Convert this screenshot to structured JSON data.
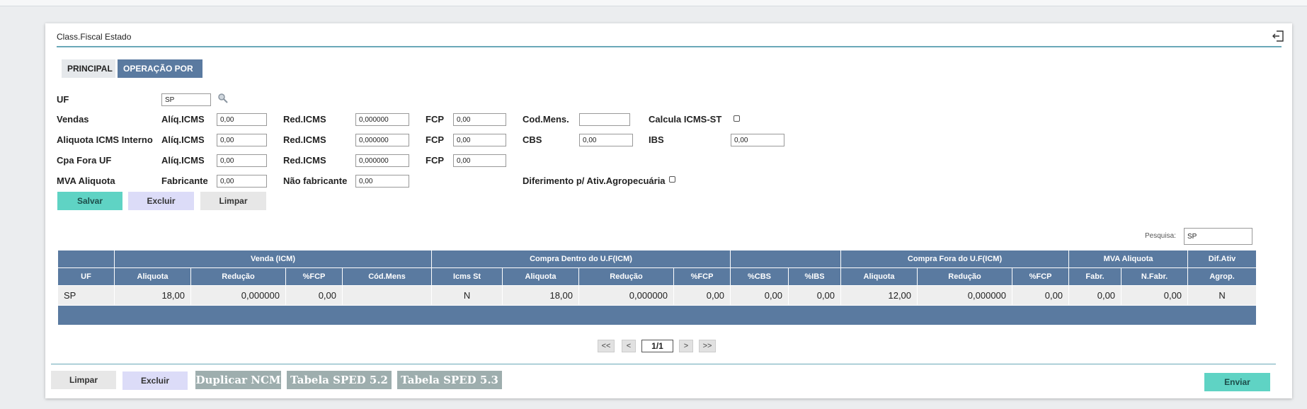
{
  "form": {
    "title": "Class.Fiscal Estado",
    "tabs": [
      "PRINCIPAL",
      "OPERAÇÃO POR UF"
    ],
    "uf_label": "UF",
    "uf_value": "SP",
    "rows": {
      "vendas": {
        "label": "Vendas",
        "aliq_label": "Alíq.ICMS",
        "aliq": "0,00",
        "red_label": "Red.ICMS",
        "red": "0,000000",
        "fcp_label": "FCP",
        "fcp": "0,00",
        "cod_label": "Cod.Mens.",
        "cod": "",
        "st_label": "Calcula ICMS-ST"
      },
      "interno": {
        "label": "Aliquota ICMS Interno",
        "aliq_label": "Alíq.ICMS",
        "aliq": "0,00",
        "red_label": "Red.ICMS",
        "red": "0,000000",
        "fcp_label": "FCP",
        "fcp": "0,00",
        "cbs_label": "CBS",
        "cbs": "0,00",
        "ibs_label": "IBS",
        "ibs": "0,00"
      },
      "cpa": {
        "label": "Cpa Fora UF",
        "aliq_label": "Alíq.ICMS",
        "aliq": "0,00",
        "red_label": "Red.ICMS",
        "red": "0,000000",
        "fcp_label": "FCP",
        "fcp": "0,00"
      },
      "mva": {
        "label": "MVA Aliquota",
        "fab_label": "Fabricante",
        "fab": "0,00",
        "nfab_label": "Não fabricante",
        "nfab": "0,00",
        "dif_label": "Diferimento p/ Ativ.Agropecuária"
      }
    },
    "buttons": {
      "save": "Salvar",
      "delete": "Excluir",
      "clear": "Limpar"
    }
  },
  "search": {
    "label": "Pesquisa:",
    "value": "SP"
  },
  "table": {
    "groups": [
      "Venda (ICM)",
      "Compra Dentro do U.F(ICM)",
      "",
      "Compra Fora do U.F(ICM)",
      "MVA Aliquota",
      "Dif.Ativ"
    ],
    "columns": [
      "UF",
      "Aliquota",
      "Redução",
      "%FCP",
      "Cód.Mens",
      "Icms St",
      "Aliquota",
      "Redução",
      "%FCP",
      "%CBS",
      "%IBS",
      "Aliquota",
      "Redução",
      "%FCP",
      "Fabr.",
      "N.Fabr.",
      "Agrop."
    ],
    "rows": [
      [
        "SP",
        "18,00",
        "0,000000",
        "0,00",
        "",
        "N",
        "18,00",
        "0,000000",
        "0,00",
        "0,00",
        "0,00",
        "12,00",
        "0,000000",
        "0,00",
        "0,00",
        "0,00",
        "N"
      ]
    ]
  },
  "pagination": {
    "first": "<<",
    "prev": "<",
    "page": "1/1",
    "next": ">",
    "last": ">>"
  },
  "footer": {
    "clear": "Limpar",
    "delete": "Excluir",
    "duplicate": "Duplicar NCM",
    "sped52": "Tabela SPED 5.2",
    "sped53": "Tabela SPED 5.3",
    "send": "Enviar"
  },
  "colors": {
    "header_blue": "#5a7aa0",
    "teal": "#5fd3c4",
    "lavender": "#dcdcf8",
    "line": "#6aa8b8"
  }
}
